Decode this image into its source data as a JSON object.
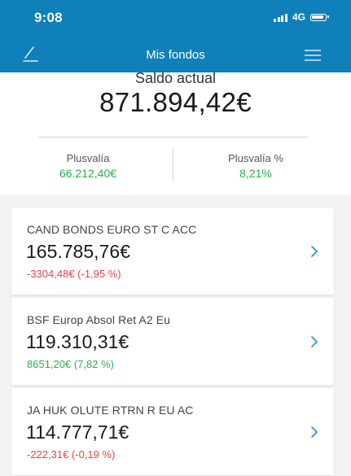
{
  "status_bar": {
    "time": "9:08",
    "network": "4G"
  },
  "nav": {
    "title": "Mis fondos"
  },
  "summary": {
    "saldo_label": "Saldo actual",
    "saldo_value": "871.894,42€",
    "plusvalia_label": "Plusvalía",
    "plusvalia_value": "66.212,40€",
    "plusvalia_pct_label": "Plusvalía %",
    "plusvalia_pct_value": "8,21%"
  },
  "funds": [
    {
      "name": "CAND BONDS EURO ST C ACC",
      "balance": "165.785,76€",
      "change": "-3304,48€ (-1,95 %)"
    },
    {
      "name": "BSF Europ Absol Ret A2 Eu",
      "balance": "119.310,31€",
      "change": "8651,20€ (7,82 %)"
    },
    {
      "name": "JA HUK OLUTE RTRN R EU AC",
      "balance": "114.777,71€",
      "change": "-222,31€ (-0,19 %)"
    }
  ],
  "colors": {
    "header": "#0f80b9",
    "positive": "#2bae4a",
    "negative": "#e8404a",
    "chevron": "#2a8fce"
  },
  "icons": {
    "back": "back-arrow-icon",
    "menu": "hamburger-menu-icon",
    "chevron": "chevron-right-icon",
    "signal": "signal-icon",
    "battery": "battery-icon"
  }
}
